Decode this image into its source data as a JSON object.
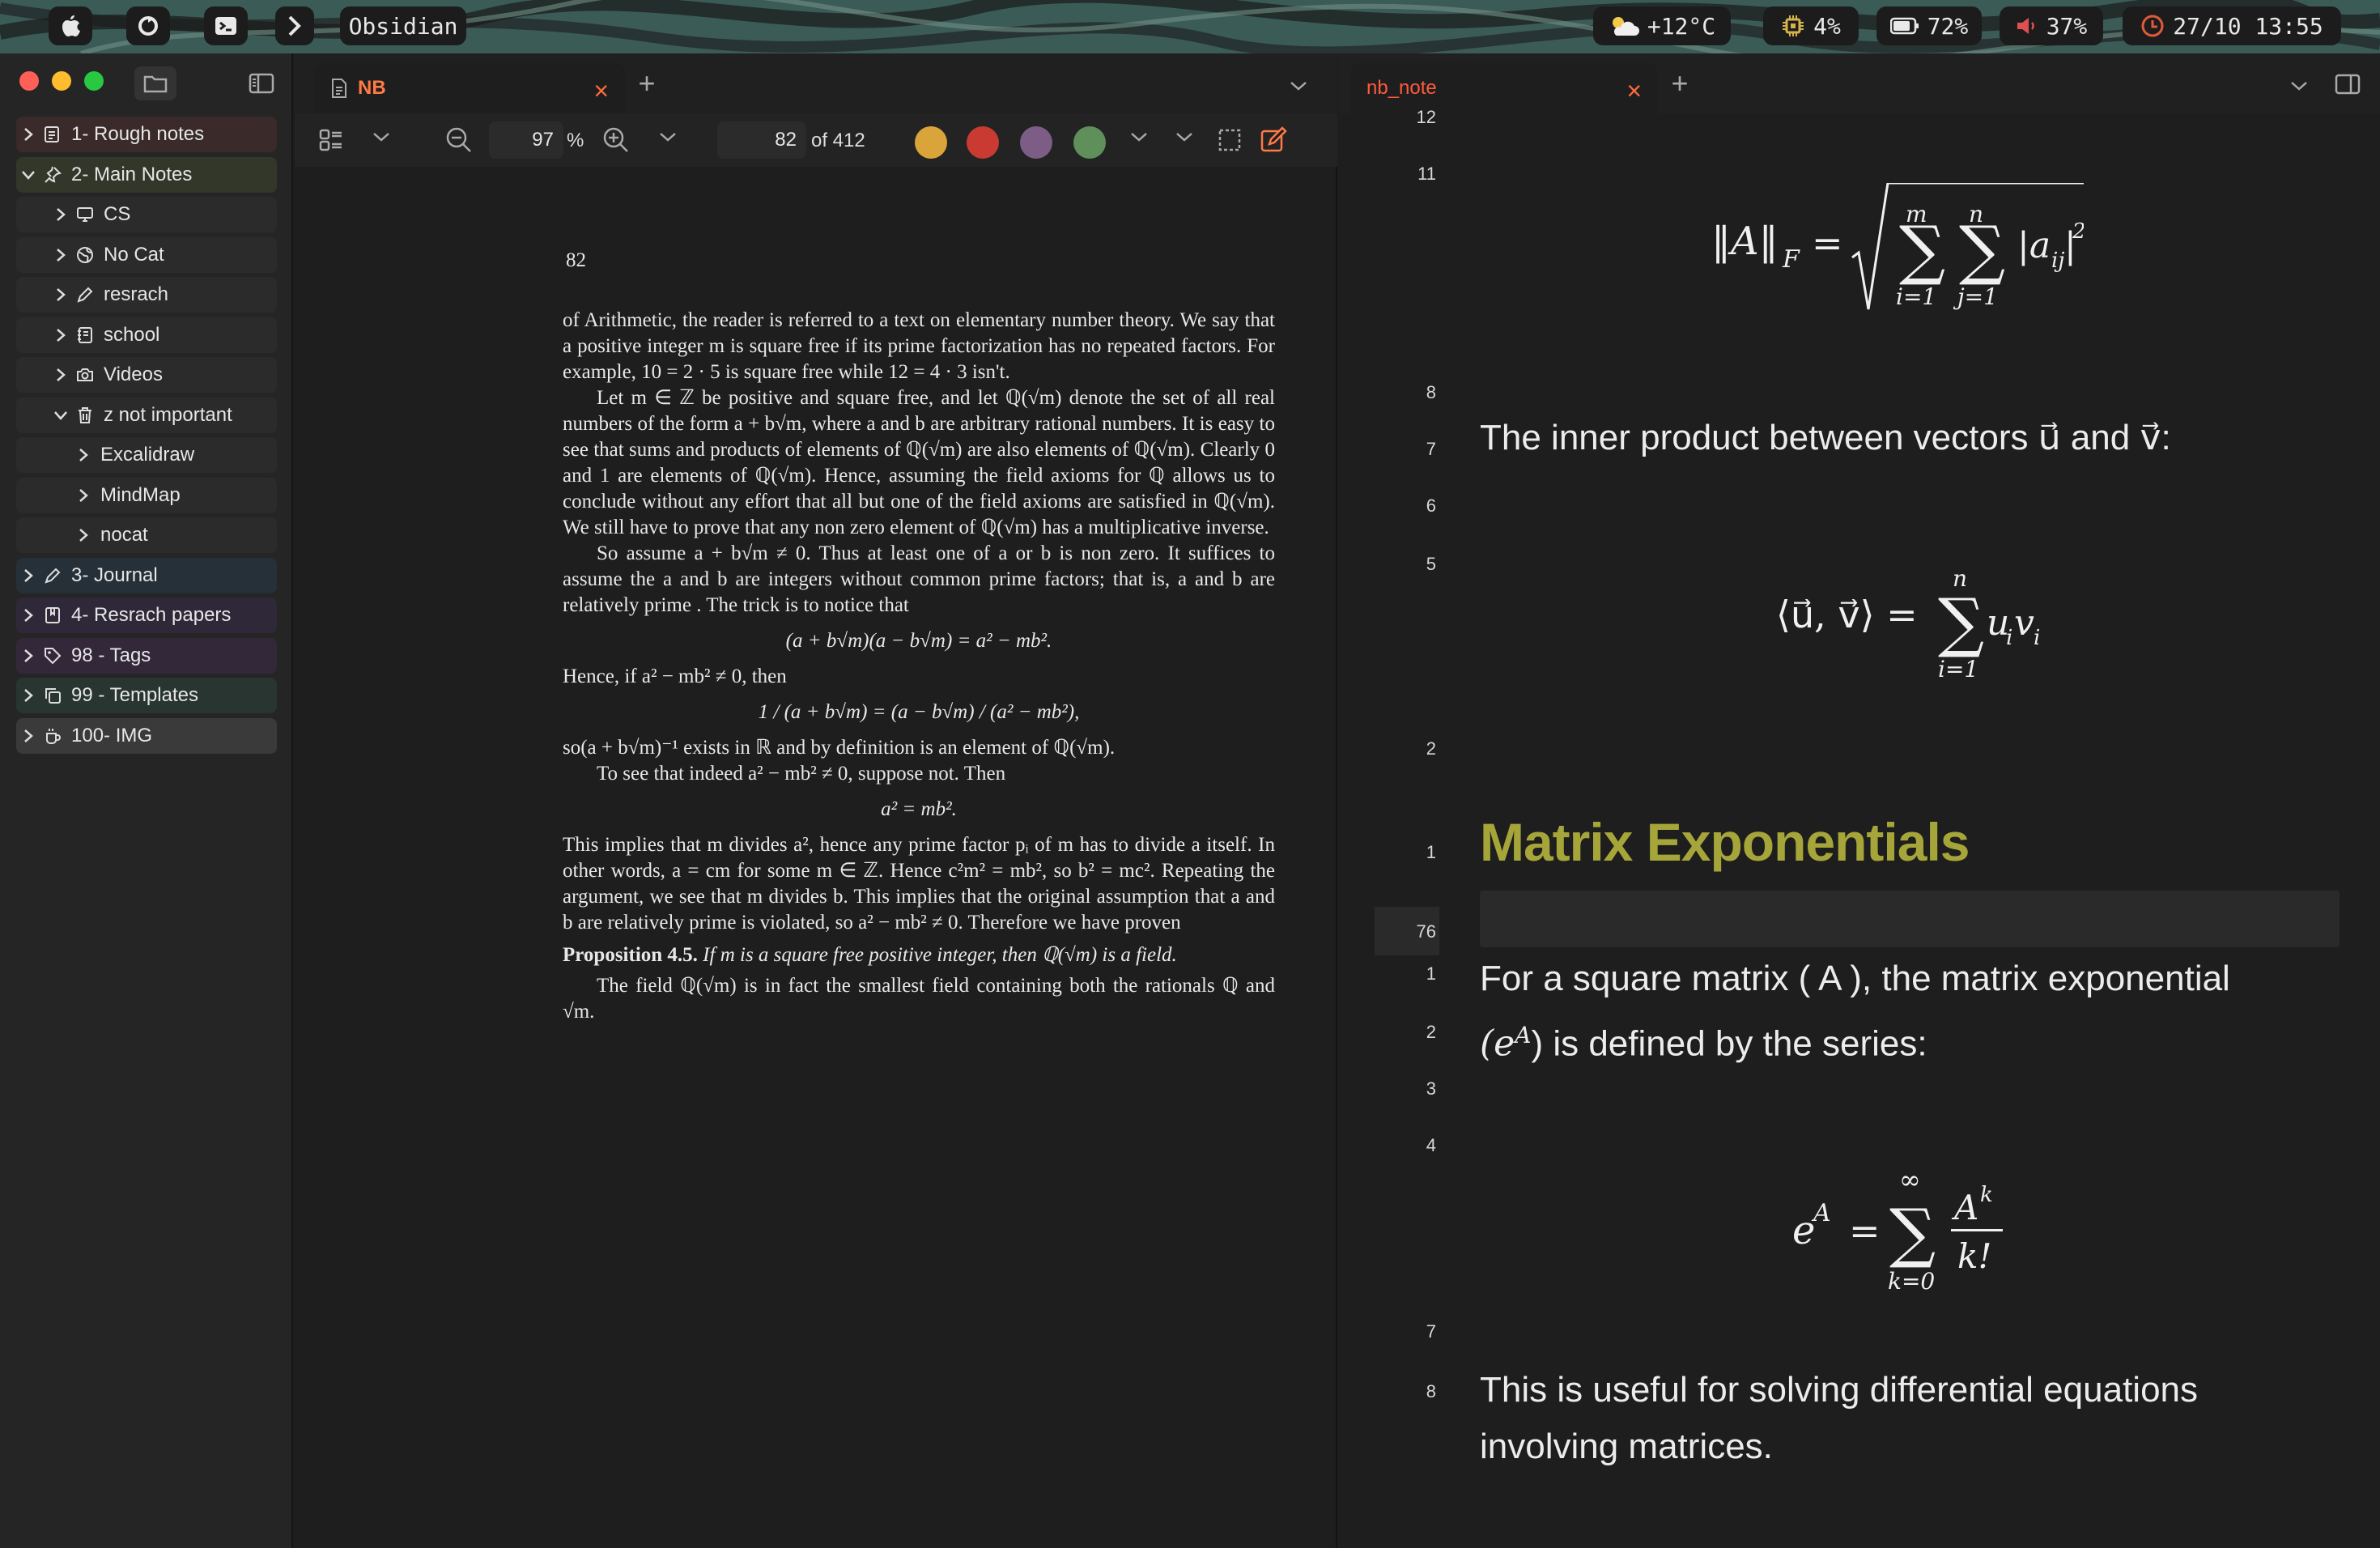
{
  "menubar": {
    "app_name": "Obsidian",
    "weather": "+12°C",
    "cpu": "4%",
    "battery": "72%",
    "volume": "37%",
    "datetime": "27/10 13:55"
  },
  "sidebar": {
    "items": [
      {
        "label": "1- Rough notes",
        "icon": "document-icon"
      },
      {
        "label": "2- Main Notes",
        "icon": "pin-icon"
      },
      {
        "label": "CS",
        "icon": "monitor-icon"
      },
      {
        "label": "No Cat",
        "icon": "globe-icon"
      },
      {
        "label": "resrach",
        "icon": "pencil-icon"
      },
      {
        "label": "school",
        "icon": "notebook-icon"
      },
      {
        "label": "Videos",
        "icon": "camera-icon"
      },
      {
        "label": "z not important",
        "icon": "trash-icon"
      },
      {
        "label": "Excalidraw",
        "icon": ""
      },
      {
        "label": "MindMap",
        "icon": ""
      },
      {
        "label": "nocat",
        "icon": ""
      },
      {
        "label": "3- Journal",
        "icon": "pencil-icon"
      },
      {
        "label": "4- Resrach papers",
        "icon": "book-icon"
      },
      {
        "label": "98 - Tags",
        "icon": "tag-icon"
      },
      {
        "label": "99 - Templates",
        "icon": "copy-icon"
      },
      {
        "label": "100- IMG",
        "icon": "image-icon"
      }
    ]
  },
  "left_pane": {
    "tab_title": "NB",
    "zoom": "97",
    "zoom_unit": "%",
    "page": "82",
    "page_total": "of 412",
    "highlight_colors": [
      "#d9a43a",
      "#c83a32",
      "#7d5d86",
      "#5f8f5a"
    ]
  },
  "pdf": {
    "page_number": "82",
    "para1": "of Arithmetic, the reader is referred to a text on elementary number theory. We say that a positive integer m is square free if its prime factorization has no repeated factors. For example, 10 = 2 · 5 is square free while 12 = 4 · 3 isn't.",
    "para2": "Let m ∈ ℤ be positive and square free, and let ℚ(√m) denote the set of all real numbers of the form a + b√m, where a and b are arbitrary rational numbers. It is easy to see that sums and products of elements of ℚ(√m) are also elements of ℚ(√m). Clearly 0 and 1 are elements of ℚ(√m). Hence, assuming the field axioms for ℚ allows us to conclude without any effort that all but one of the field axioms are satisfied in ℚ(√m). We still have to prove that any non zero element of ℚ(√m) has a multiplicative inverse.",
    "para3": "So assume a + b√m ≠ 0. Thus at least one of a or b is non zero. It suffices to assume the a and b are integers without common prime factors; that is, a and b are relatively prime . The trick is to notice that",
    "eq1": "(a + b√m)(a − b√m) = a² − mb².",
    "para4": "Hence, if a² − mb² ≠ 0, then",
    "eq2": "1 / (a + b√m) = (a − b√m) / (a² − mb²),",
    "para5": "so(a + b√m)⁻¹ exists in ℝ and by definition is an element of ℚ(√m).",
    "para6": "To see that indeed a² − mb² ≠ 0, suppose not. Then",
    "eq3": "a² = mb².",
    "para7": "This implies that m divides a², hence any prime factor pᵢ of m has to divide a itself. In other words, a = cm for some m ∈ ℤ. Hence c²m² = mb², so b² = mc². Repeating the argument, we see that m divides b. This implies that the original assumption that a and b are relatively prime is violated, so a² − mb² ≠ 0. Therefore we have proven",
    "prop_label": "Proposition 4.5.",
    "prop_text": "If m is a square free positive integer, then ℚ(√m) is a field.",
    "para8": "The field ℚ(√m) is in fact the smallest field containing both the rationals ℚ and √m."
  },
  "right_pane": {
    "tab_title": "nb_note",
    "gutter": [
      "12",
      "11",
      "8",
      "7",
      "6",
      "5",
      "2",
      "1",
      "76",
      "1",
      "2",
      "3",
      "4",
      "7",
      "8"
    ],
    "frobenius_lhs": "‖A‖",
    "inner_product_text": "The inner product between vectors u⃗ and v⃗:",
    "inner_product_formula": "⟨u⃗, v⃗⟩ =",
    "heading": "Matrix Exponentials",
    "definition_line1": "For a square matrix ( A ), the matrix exponential",
    "definition_line2": "(e",
    "definition_line2_sup": "A",
    "definition_line2_rest": ") is defined by the series:",
    "closing_line1": "This is useful for solving differential equations",
    "closing_line2": "involving matrices."
  }
}
